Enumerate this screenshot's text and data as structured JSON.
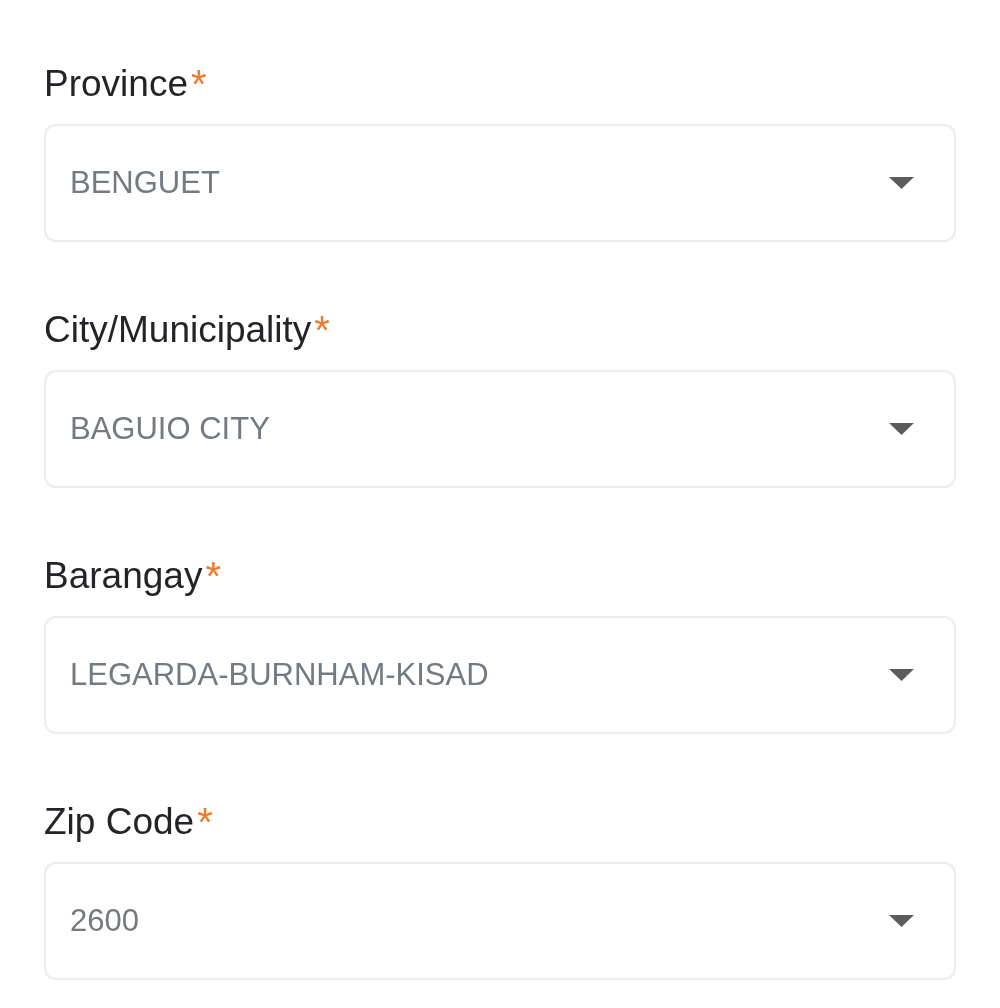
{
  "fields": [
    {
      "label": "Province",
      "required_mark": "*",
      "value": "BENGUET"
    },
    {
      "label": "City/Municipality",
      "required_mark": "*",
      "value": "BAGUIO CITY"
    },
    {
      "label": "Barangay",
      "required_mark": "*",
      "value": "LEGARDA-BURNHAM-KISAD"
    },
    {
      "label": "Zip Code",
      "required_mark": "*",
      "value": "2600"
    }
  ]
}
